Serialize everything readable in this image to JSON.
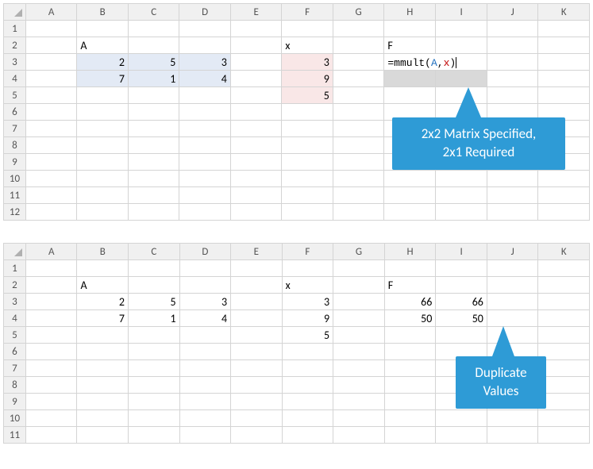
{
  "sheet1": {
    "columns": [
      "A",
      "B",
      "C",
      "D",
      "E",
      "F",
      "G",
      "H",
      "I",
      "J",
      "K"
    ],
    "rows": [
      "1",
      "2",
      "3",
      "4",
      "5",
      "6",
      "7",
      "8",
      "9",
      "10",
      "11",
      "12"
    ],
    "labels": {
      "A": "A",
      "x": "x",
      "F": "F"
    },
    "matrixA": [
      [
        "2",
        "5",
        "3"
      ],
      [
        "7",
        "1",
        "4"
      ]
    ],
    "vecX": [
      "3",
      "9",
      "5"
    ],
    "formula_prefix": "=mmult(",
    "formula_arg1": "A",
    "formula_sep": ",",
    "formula_arg2": "x",
    "formula_suffix": ")",
    "callout": {
      "line1": "2x2 Matrix Specified,",
      "line2": "2x1 Required"
    }
  },
  "sheet2": {
    "columns": [
      "A",
      "B",
      "C",
      "D",
      "E",
      "F",
      "G",
      "H",
      "I",
      "J",
      "K"
    ],
    "rows": [
      "1",
      "2",
      "3",
      "4",
      "5",
      "6",
      "7",
      "8",
      "9",
      "10",
      "11"
    ],
    "labels": {
      "A": "A",
      "x": "x",
      "F": "F"
    },
    "matrixA": [
      [
        "2",
        "5",
        "3"
      ],
      [
        "7",
        "1",
        "4"
      ]
    ],
    "vecX": [
      "3",
      "9",
      "5"
    ],
    "result": [
      [
        "66",
        "66"
      ],
      [
        "50",
        "50"
      ]
    ],
    "callout": {
      "line1": "Duplicate",
      "line2": "Values"
    }
  }
}
